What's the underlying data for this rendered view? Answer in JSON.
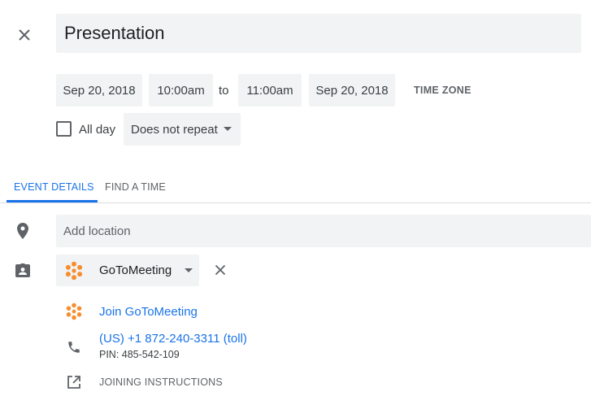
{
  "event": {
    "title": "Presentation"
  },
  "datetime": {
    "start_date": "Sep 20, 2018",
    "start_time": "10:00am",
    "to_label": "to",
    "end_time": "11:00am",
    "end_date": "Sep 20, 2018",
    "timezone_label": "TIME ZONE"
  },
  "options": {
    "all_day_label": "All day",
    "all_day_checked": false,
    "repeat_value": "Does not repeat"
  },
  "tabs": [
    {
      "label": "EVENT DETAILS",
      "active": true
    },
    {
      "label": "FIND A TIME",
      "active": false
    }
  ],
  "location": {
    "placeholder": "Add location"
  },
  "conference": {
    "provider": "GoToMeeting",
    "join_label": "Join GoToMeeting",
    "phone": "(US) +1 872-240-3311 (toll)",
    "pin": "PIN: 485-542-109",
    "instructions_label": "JOINING INSTRUCTIONS"
  },
  "colors": {
    "accent": "#1a73e8",
    "gotomeeting_orange": "#f68d2e",
    "field_bg": "#f1f3f4",
    "icon_gray": "#5f6368"
  },
  "icons": {
    "close": "close-icon",
    "location": "location-pin-icon",
    "conference": "contact-card-icon",
    "provider": "gotomeeting-logo-icon",
    "phone": "phone-icon",
    "open": "open-in-new-icon"
  }
}
